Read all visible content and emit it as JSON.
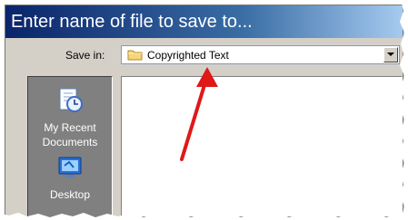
{
  "dialog": {
    "title": "Enter name of file to save to..."
  },
  "save_in": {
    "label": "Save in:",
    "value": "Copyrighted Text",
    "folder_icon": "folder-icon",
    "dropdown_icon": "chevron-down-icon"
  },
  "places": [
    {
      "label": "My Recent Documents",
      "icon": "recent-documents-icon"
    },
    {
      "label": "Desktop",
      "icon": "desktop-icon"
    }
  ],
  "annotation": {
    "color": "#e01818"
  }
}
